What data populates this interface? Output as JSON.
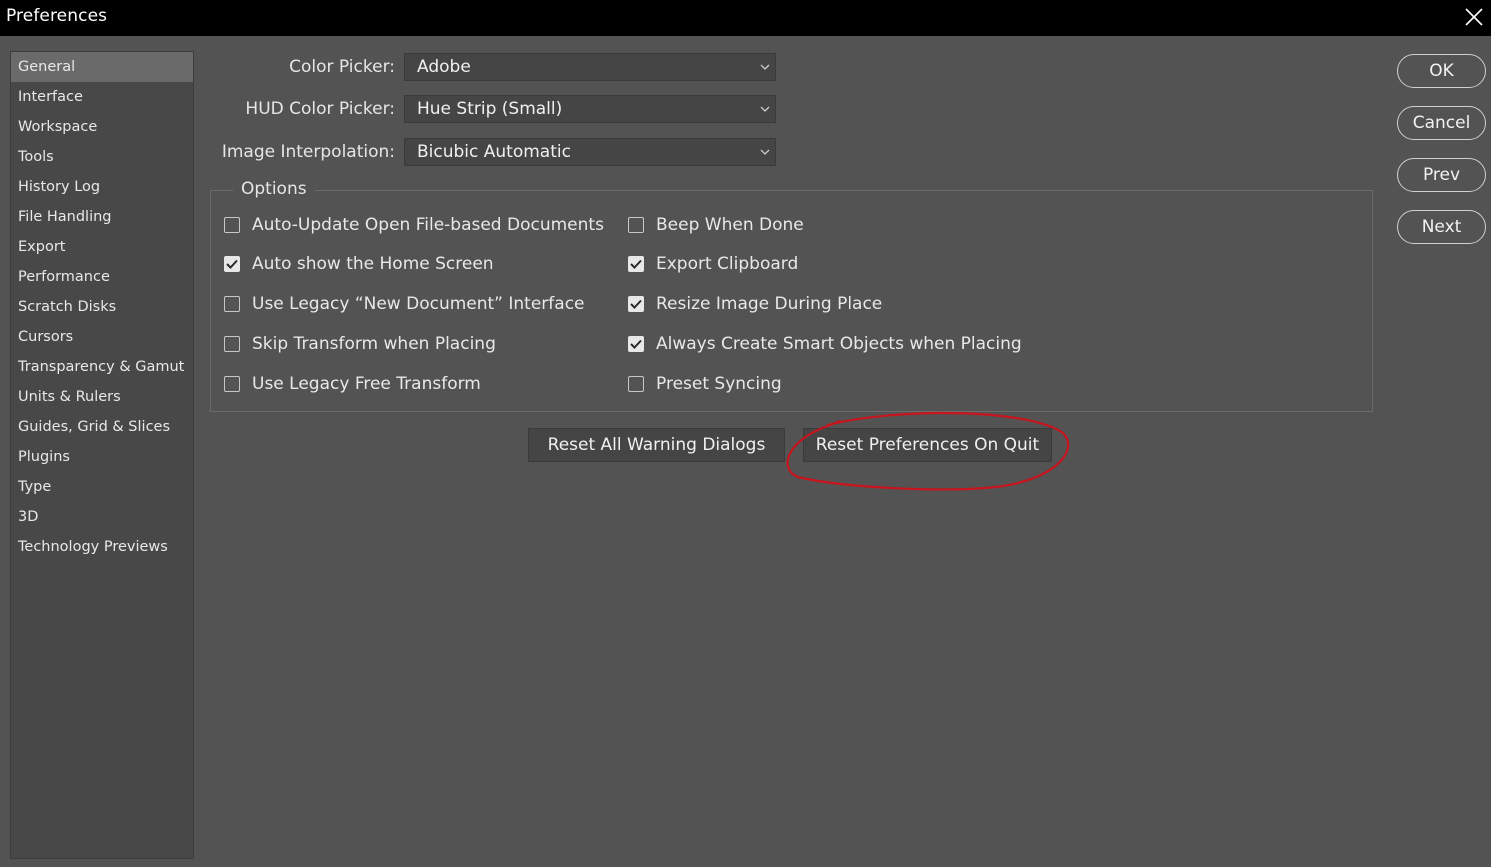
{
  "window": {
    "title": "Preferences",
    "close_icon": "close-icon"
  },
  "sidebar": {
    "items": [
      {
        "label": "General",
        "active": true
      },
      {
        "label": "Interface"
      },
      {
        "label": "Workspace"
      },
      {
        "label": "Tools"
      },
      {
        "label": "History Log"
      },
      {
        "label": "File Handling"
      },
      {
        "label": "Export"
      },
      {
        "label": "Performance"
      },
      {
        "label": "Scratch Disks"
      },
      {
        "label": "Cursors"
      },
      {
        "label": "Transparency & Gamut"
      },
      {
        "label": "Units & Rulers"
      },
      {
        "label": "Guides, Grid & Slices"
      },
      {
        "label": "Plugins"
      },
      {
        "label": "Type"
      },
      {
        "label": "3D"
      },
      {
        "label": "Technology Previews"
      }
    ]
  },
  "fields": {
    "color_picker": {
      "label": "Color Picker:",
      "value": "Adobe"
    },
    "hud_color_picker": {
      "label": "HUD Color Picker:",
      "value": "Hue Strip (Small)"
    },
    "image_interpolation": {
      "label": "Image Interpolation:",
      "value": "Bicubic Automatic"
    }
  },
  "options": {
    "legend": "Options",
    "left": [
      {
        "label": "Auto-Update Open File-based Documents",
        "checked": false
      },
      {
        "label": "Auto show the Home Screen",
        "checked": true
      },
      {
        "label": "Use Legacy “New Document” Interface",
        "checked": false
      },
      {
        "label": "Skip Transform when Placing",
        "checked": false
      },
      {
        "label": "Use Legacy Free Transform",
        "checked": false
      }
    ],
    "right": [
      {
        "label": "Beep When Done",
        "checked": false
      },
      {
        "label": "Export Clipboard",
        "checked": true
      },
      {
        "label": "Resize Image During Place",
        "checked": true
      },
      {
        "label": "Always Create Smart Objects when Placing",
        "checked": true
      },
      {
        "label": "Preset Syncing",
        "checked": false
      }
    ]
  },
  "actions": {
    "reset_warnings": "Reset All Warning Dialogs",
    "reset_prefs": "Reset Preferences On Quit"
  },
  "dialog_buttons": {
    "ok": "OK",
    "cancel": "Cancel",
    "prev": "Prev",
    "next": "Next"
  },
  "colors": {
    "background": "#535353",
    "titlebar": "#000000",
    "annotation": "#c8141e"
  }
}
